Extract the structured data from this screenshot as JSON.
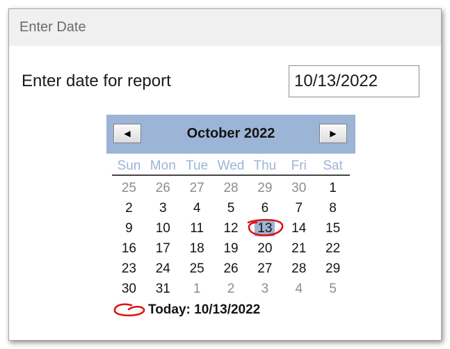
{
  "window": {
    "title": "Enter Date"
  },
  "form": {
    "prompt": "Enter date for report",
    "date_value": "10/13/2022"
  },
  "calendar": {
    "month_label": "October 2022",
    "prev_icon": "◀",
    "next_icon": "▶",
    "weekdays": [
      "Sun",
      "Mon",
      "Tue",
      "Wed",
      "Thu",
      "Fri",
      "Sat"
    ],
    "weeks": [
      [
        {
          "d": "25",
          "other": true
        },
        {
          "d": "26",
          "other": true
        },
        {
          "d": "27",
          "other": true
        },
        {
          "d": "28",
          "other": true
        },
        {
          "d": "29",
          "other": true
        },
        {
          "d": "30",
          "other": true
        },
        {
          "d": "1"
        }
      ],
      [
        {
          "d": "2"
        },
        {
          "d": "3"
        },
        {
          "d": "4"
        },
        {
          "d": "5"
        },
        {
          "d": "6"
        },
        {
          "d": "7"
        },
        {
          "d": "8"
        }
      ],
      [
        {
          "d": "9"
        },
        {
          "d": "10"
        },
        {
          "d": "11"
        },
        {
          "d": "12"
        },
        {
          "d": "13",
          "selected": true
        },
        {
          "d": "14"
        },
        {
          "d": "15"
        }
      ],
      [
        {
          "d": "16"
        },
        {
          "d": "17"
        },
        {
          "d": "18"
        },
        {
          "d": "19"
        },
        {
          "d": "20"
        },
        {
          "d": "21"
        },
        {
          "d": "22"
        }
      ],
      [
        {
          "d": "23"
        },
        {
          "d": "24"
        },
        {
          "d": "25"
        },
        {
          "d": "26"
        },
        {
          "d": "27"
        },
        {
          "d": "28"
        },
        {
          "d": "29"
        }
      ],
      [
        {
          "d": "30"
        },
        {
          "d": "31"
        },
        {
          "d": "1",
          "other": true
        },
        {
          "d": "2",
          "other": true
        },
        {
          "d": "3",
          "other": true
        },
        {
          "d": "4",
          "other": true
        },
        {
          "d": "5",
          "other": true
        }
      ]
    ],
    "today_label": "Today: 10/13/2022"
  },
  "colors": {
    "header": "#9cb4d6",
    "annotation": "#e01010"
  }
}
